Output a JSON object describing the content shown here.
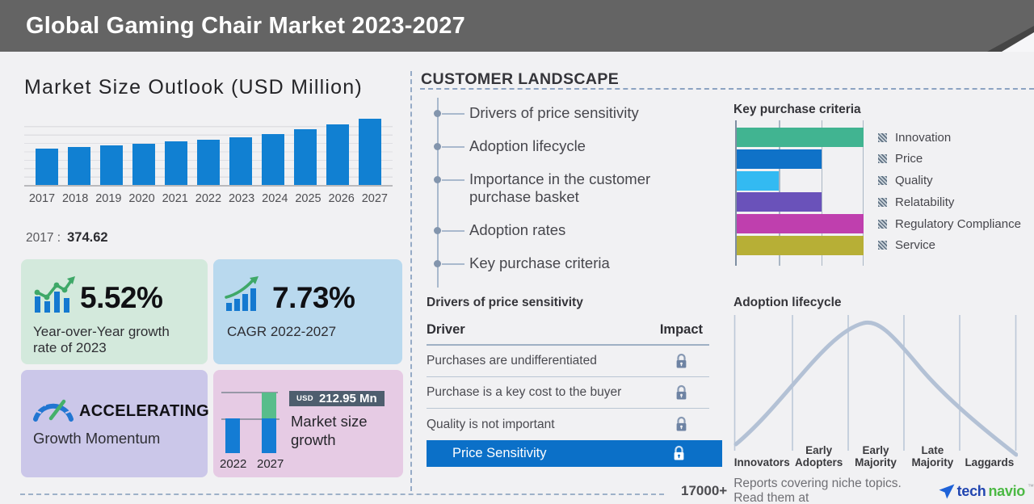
{
  "header": {
    "title": "Global Gaming Chair Market 2023-2027"
  },
  "market_size": {
    "title": "Market Size Outlook (USD Million)",
    "base_year_label": "2017 :",
    "base_year_value": "374.62"
  },
  "chart_data": [
    {
      "type": "bar",
      "title": "Market Size Outlook (USD Million)",
      "categories": [
        "2017",
        "2018",
        "2019",
        "2020",
        "2021",
        "2022",
        "2023",
        "2024",
        "2025",
        "2026",
        "2027"
      ],
      "values": [
        374.62,
        392,
        411,
        431,
        451,
        472,
        498,
        531,
        576,
        626,
        685
      ],
      "ylabel": "USD Million",
      "ylim": [
        0,
        705
      ],
      "grid": "horizontal",
      "bar_color": "#1180d2",
      "annotations": [
        "2017 : 374.62"
      ]
    },
    {
      "type": "bar",
      "orientation": "horizontal",
      "title": "Key purchase criteria",
      "categories": [
        "Innovation",
        "Price",
        "Quality",
        "Relatability",
        "Regulatory Compliance",
        "Service"
      ],
      "values": [
        3,
        2,
        1,
        2,
        3,
        3
      ],
      "xlim": [
        0,
        3
      ],
      "grid": "vertical",
      "colors": [
        "#41b491",
        "#0f72c8",
        "#33baf2",
        "#6a52ba",
        "#bf3fae",
        "#b7af36"
      ],
      "legend_position": "right"
    },
    {
      "type": "bar",
      "title": "Market size growth",
      "categories": [
        "2022",
        "2027"
      ],
      "series": [
        {
          "name": "base",
          "values": [
            471.9,
            471.9
          ]
        },
        {
          "name": "growth",
          "values": [
            0,
            212.95
          ]
        }
      ],
      "annotations": [
        "USD 212.95 Mn"
      ],
      "colors": [
        "#147cd4",
        "#58bd8b"
      ]
    },
    {
      "type": "line",
      "title": "Adoption lifecycle",
      "shape": "bell-curve",
      "categories": [
        "Innovators",
        "Early Adopters",
        "Early Majority",
        "Late Majority",
        "Laggards"
      ],
      "peak": "Early Majority",
      "line_color": "#b3c1d5"
    }
  ],
  "stats": {
    "yoy": {
      "value": "5.52%",
      "label": "Year-over-Year growth rate of 2023"
    },
    "cagr": {
      "value": "7.73%",
      "label": "CAGR 2022-2027"
    },
    "momentum": {
      "value": "ACCELERATING",
      "label": "Growth Momentum"
    },
    "growth": {
      "currency": "USD",
      "amount": "212.95 Mn",
      "label": "Market size growth",
      "year_from": "2022",
      "year_to": "2027"
    }
  },
  "customer_landscape": {
    "title": "CUSTOMER LANDSCAPE",
    "items": [
      "Drivers of price sensitivity",
      "Adoption lifecycle",
      "Importance in the customer purchase basket",
      "Adoption rates",
      "Key purchase criteria"
    ]
  },
  "key_purchase": {
    "title": "Key purchase criteria"
  },
  "drivers": {
    "title": "Drivers of price sensitivity",
    "columns": {
      "driver": "Driver",
      "impact": "Impact"
    },
    "rows": [
      "Purchases are undifferentiated",
      "Purchase is a key cost to the buyer",
      "Quality is not important"
    ],
    "highlight": "Price Sensitivity",
    "impact_icon": "lock-icon"
  },
  "adoption": {
    "title": "Adoption lifecycle"
  },
  "footer": {
    "count": "17000+",
    "text": "Reports covering niche topics. Read them at",
    "brand": {
      "icon": "technavio-arrow-icon",
      "tech": "tech",
      "navio": "navio",
      "tm": "™"
    }
  },
  "colors": {
    "page_bg": "#f1f1f3",
    "header_bg": "#646464",
    "primary_bar": "#1180d2",
    "box_green": "#d3e9dc",
    "box_blue": "#b9d9ee",
    "box_purple": "#cbc7e9",
    "box_pink": "#e6cbe4",
    "badge_bg": "#4e5e6e",
    "highlight_row": "#0b70c8",
    "curve": "#b3c1d5",
    "lock": "#6e83a3"
  }
}
